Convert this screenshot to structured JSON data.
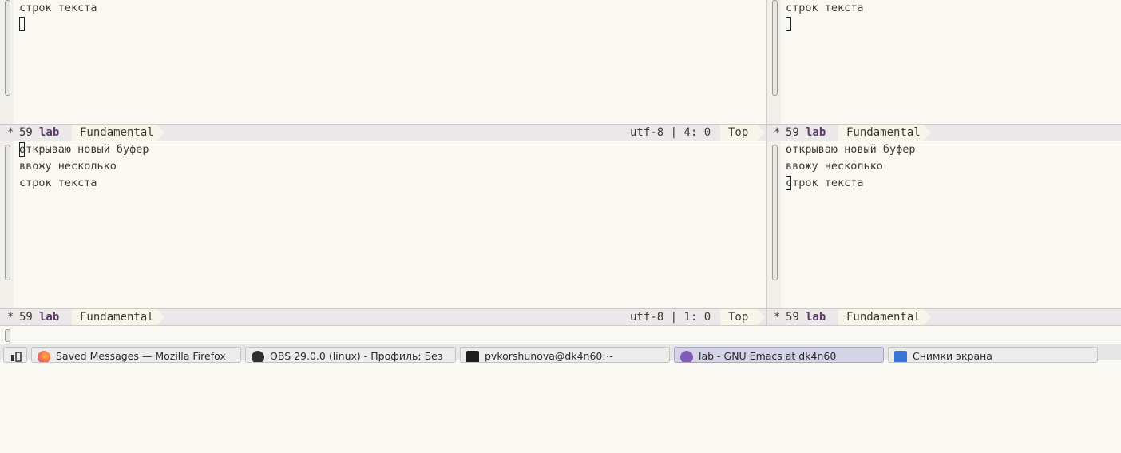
{
  "panes": {
    "top_left": {
      "lines": [
        "строк текста"
      ],
      "modeline": {
        "modified": "*",
        "line_number": "59",
        "buffer_name": "lab",
        "major_mode": "Fundamental",
        "encoding": "utf-8 | 4: 0",
        "position": "Top"
      }
    },
    "top_right": {
      "lines": [
        "строк текста"
      ],
      "modeline": {
        "modified": "*",
        "line_number": "59",
        "buffer_name": "lab",
        "major_mode": "Fundamental"
      }
    },
    "bottom_left": {
      "lines": [
        "открываю новый буфер",
        "ввожу несколько",
        "строк текста"
      ],
      "modeline": {
        "modified": "*",
        "line_number": "59",
        "buffer_name": "lab",
        "major_mode": "Fundamental",
        "encoding": "utf-8 | 1: 0",
        "position": "Top"
      }
    },
    "bottom_right": {
      "lines": [
        "открываю новый буфер",
        "ввожу несколько",
        "строк текста"
      ],
      "modeline": {
        "modified": "*",
        "line_number": "59",
        "buffer_name": "lab",
        "major_mode": "Fundamental"
      }
    }
  },
  "taskbar": {
    "tasks": [
      {
        "label": "Saved Messages — Mozilla Firefox",
        "icon": "firefox-icon",
        "active": false
      },
      {
        "label": "OBS 29.0.0 (linux) - Профиль: Без",
        "icon": "obs-icon",
        "active": false
      },
      {
        "label": "pvkorshunova@dk4n60:~",
        "icon": "terminal-icon",
        "active": false
      },
      {
        "label": "lab - GNU Emacs at dk4n60",
        "icon": "emacs-icon",
        "active": true
      },
      {
        "label": "Снимки экрана",
        "icon": "folder-icon",
        "active": false
      }
    ]
  },
  "colors": {
    "background": "#faf8f2",
    "modeline_bg": "#ebe8ea",
    "buffer_name": "#5c3b6b",
    "text": "#3d3a36"
  }
}
